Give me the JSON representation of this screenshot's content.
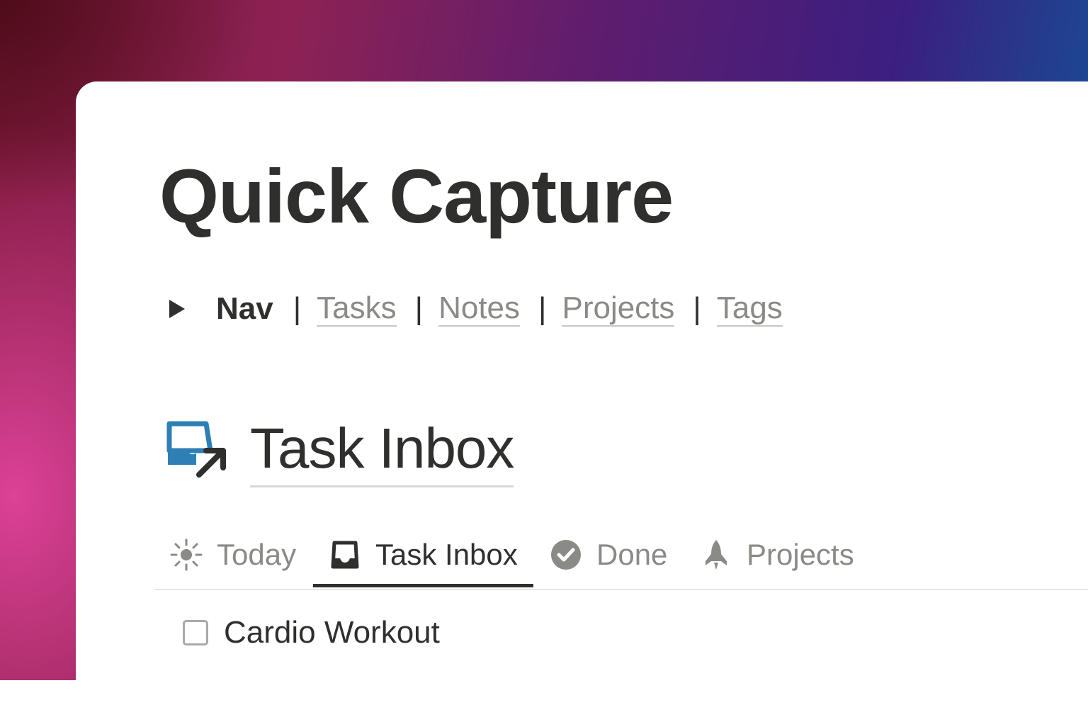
{
  "page": {
    "title": "Quick Capture"
  },
  "nav": {
    "label": "Nav",
    "separator": "|",
    "links": [
      "Tasks",
      "Notes",
      "Projects",
      "Tags"
    ]
  },
  "database": {
    "icon": "inbox-arrow-icon",
    "title": "Task Inbox"
  },
  "tabs": [
    {
      "label": "Today",
      "icon": "sun-icon",
      "active": false
    },
    {
      "label": "Task Inbox",
      "icon": "inbox-tray-icon",
      "active": true
    },
    {
      "label": "Done",
      "icon": "check-circle-icon",
      "active": false
    },
    {
      "label": "Projects",
      "icon": "rocket-icon",
      "active": false
    }
  ],
  "tasks": [
    {
      "label": "Cardio Workout",
      "checked": false
    }
  ],
  "colors": {
    "text": "#2f2f2d",
    "muted": "#8a8a87",
    "accent_icon": "#2e7fb5",
    "background": "#ffffff"
  }
}
